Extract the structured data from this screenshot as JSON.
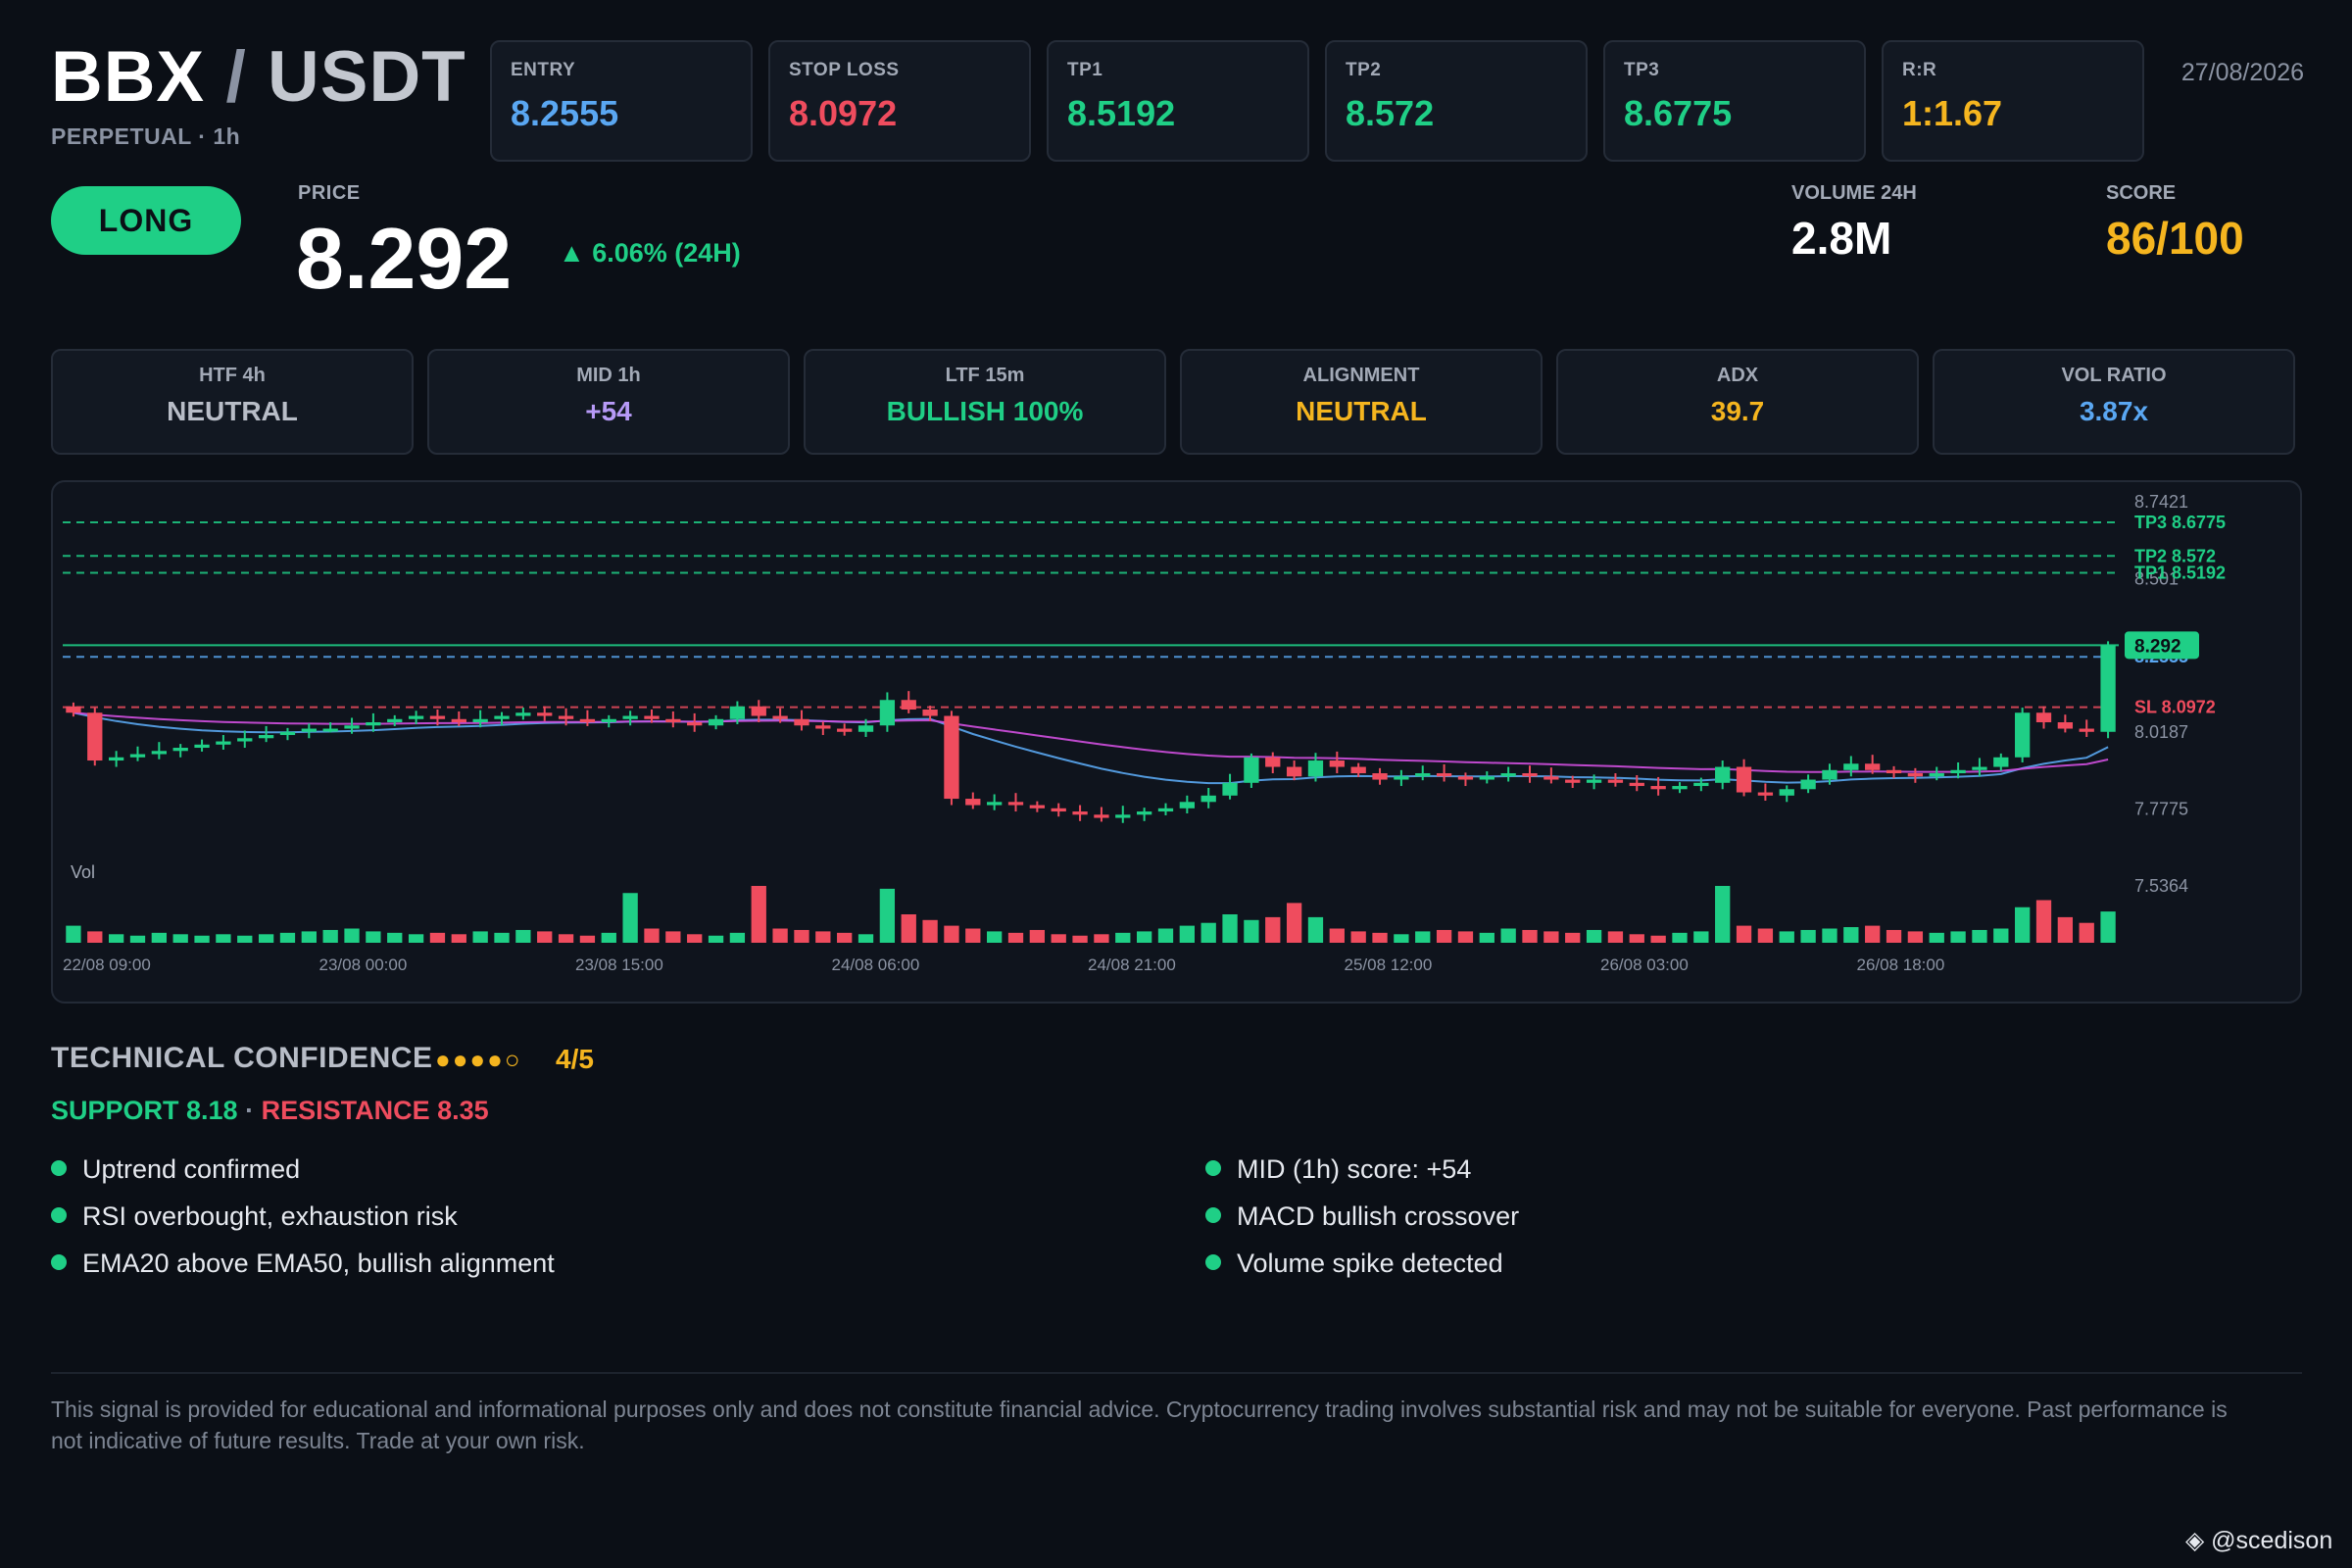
{
  "header": {
    "base": "BBX",
    "separator": "/",
    "quote": "USDT",
    "subtitle": "PERPETUAL · 1h",
    "date": "27/08/2026"
  },
  "trade_cards": [
    {
      "label": "ENTRY",
      "value": "8.2555",
      "color": "#5aa7f2"
    },
    {
      "label": "STOP LOSS",
      "value": "8.0972",
      "color": "#ef4c5e"
    },
    {
      "label": "TP1",
      "value": "8.5192",
      "color": "#1fcf86"
    },
    {
      "label": "TP2",
      "value": "8.572",
      "color": "#1fcf86"
    },
    {
      "label": "TP3",
      "value": "8.6775",
      "color": "#1fcf86"
    },
    {
      "label": "R:R",
      "value": "1:1.67",
      "color": "#f5b51f"
    }
  ],
  "direction": "LONG",
  "price": {
    "label": "PRICE",
    "value": "8.292",
    "change": "▲ 6.06% (24H)"
  },
  "volume": {
    "label": "VOLUME 24H",
    "value": "2.8M"
  },
  "score": {
    "label": "SCORE",
    "value": "86/100"
  },
  "metrics": [
    {
      "label": "HTF 4h",
      "value": "NEUTRAL",
      "color": "#b8bdc7"
    },
    {
      "label": "MID 1h",
      "value": "+54",
      "color": "#b79af7"
    },
    {
      "label": "LTF 15m",
      "value": "BULLISH 100%",
      "color": "#1fcf86"
    },
    {
      "label": "ALIGNMENT",
      "value": "NEUTRAL",
      "color": "#f5b51f"
    },
    {
      "label": "ADX",
      "value": "39.7",
      "color": "#f5b51f"
    },
    {
      "label": "VOL RATIO",
      "value": "3.87x",
      "color": "#5aa7f2"
    }
  ],
  "chart_data": {
    "type": "candlestick",
    "y_ticks": [
      "8.7421",
      "8.501",
      "8.0187",
      "7.7775",
      "7.5364"
    ],
    "x_ticks": [
      "22/08 09:00",
      "23/08 00:00",
      "23/08 15:00",
      "24/08 06:00",
      "24/08 21:00",
      "25/08 12:00",
      "26/08 03:00",
      "26/08 18:00"
    ],
    "levels": [
      {
        "label": "TP3 8.6775",
        "value": 8.6775,
        "color": "#1fcf86"
      },
      {
        "label": "TP2 8.572",
        "value": 8.572,
        "color": "#1fcf86"
      },
      {
        "label": "TP1 8.5192",
        "value": 8.5192,
        "color": "#1fcf86"
      },
      {
        "label": "8.2555",
        "value": 8.2555,
        "color": "#5aa7f2"
      },
      {
        "label": "SL 8.0972",
        "value": 8.0972,
        "color": "#ef4c5e"
      }
    ],
    "current_price": {
      "label": "8.292",
      "value": 8.292,
      "color": "#1fcf86"
    },
    "volume_label": "Vol",
    "closes": [
      8.08,
      7.93,
      7.94,
      7.95,
      7.96,
      7.97,
      7.98,
      7.99,
      8.0,
      8.01,
      8.02,
      8.03,
      8.03,
      8.04,
      8.05,
      8.06,
      8.07,
      8.06,
      8.05,
      8.06,
      8.07,
      8.08,
      8.07,
      8.06,
      8.05,
      8.06,
      8.07,
      8.06,
      8.05,
      8.04,
      8.06,
      8.1,
      8.07,
      8.06,
      8.04,
      8.03,
      8.02,
      8.04,
      8.12,
      8.09,
      8.07,
      7.81,
      7.79,
      7.8,
      7.79,
      7.78,
      7.77,
      7.76,
      7.75,
      7.76,
      7.77,
      7.78,
      7.8,
      7.82,
      7.86,
      7.94,
      7.91,
      7.88,
      7.93,
      7.91,
      7.89,
      7.87,
      7.88,
      7.89,
      7.88,
      7.87,
      7.88,
      7.89,
      7.88,
      7.87,
      7.86,
      7.87,
      7.86,
      7.85,
      7.84,
      7.85,
      7.86,
      7.91,
      7.83,
      7.82,
      7.84,
      7.87,
      7.9,
      7.92,
      7.9,
      7.89,
      7.88,
      7.89,
      7.9,
      7.91,
      7.94,
      8.08,
      8.05,
      8.03,
      8.02,
      8.292
    ],
    "volumes": [
      12,
      8,
      6,
      5,
      7,
      6,
      5,
      6,
      5,
      6,
      7,
      8,
      9,
      10,
      8,
      7,
      6,
      7,
      6,
      8,
      7,
      9,
      8,
      6,
      5,
      7,
      35,
      10,
      8,
      6,
      5,
      7,
      40,
      10,
      9,
      8,
      7,
      6,
      38,
      20,
      16,
      12,
      10,
      8,
      7,
      9,
      6,
      5,
      6,
      7,
      8,
      10,
      12,
      14,
      20,
      16,
      18,
      28,
      18,
      10,
      8,
      7,
      6,
      8,
      9,
      8,
      7,
      10,
      9,
      8,
      7,
      9,
      8,
      6,
      5,
      7,
      8,
      40,
      12,
      10,
      8,
      9,
      10,
      11,
      12,
      9,
      8,
      7,
      8,
      9,
      10,
      25,
      30,
      18,
      14,
      22
    ]
  },
  "technical": {
    "title": "TECHNICAL CONFIDENCE",
    "dots": "●●●●○",
    "score": "4/5",
    "support": "SUPPORT 8.18",
    "separator": " · ",
    "resistance": "RESISTANCE 8.35",
    "bullets_left": [
      "Uptrend confirmed",
      "RSI overbought, exhaustion risk",
      "EMA20 above EMA50, bullish alignment"
    ],
    "bullets_right": [
      "MID (1h) score: +54",
      "MACD bullish crossover",
      "Volume spike detected"
    ]
  },
  "disclaimer": "This signal is provided for educational and informational purposes only and does not constitute financial advice. Cryptocurrency trading involves substantial risk and may not be suitable for everyone. Past performance is not indicative of future results. Trade at your own risk.",
  "watermark": "@scedison",
  "colors": {
    "green": "#1fcf86",
    "red": "#ef4c5e",
    "blue": "#5aa7f2",
    "yellow": "#f5b51f",
    "purple": "#b79af7",
    "background": "#0b0f16"
  }
}
